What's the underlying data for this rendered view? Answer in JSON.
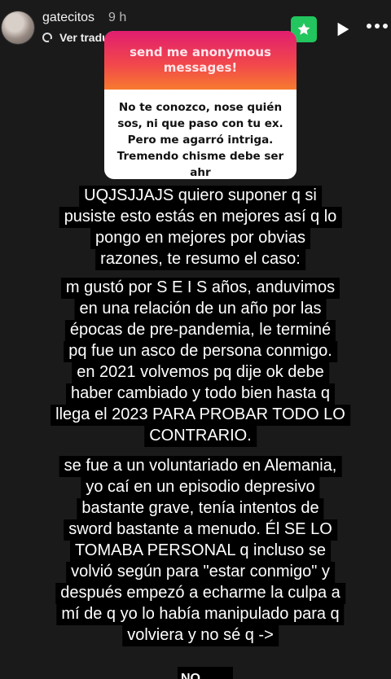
{
  "header": {
    "username": "gatecitos",
    "time": "9 h",
    "translate_label": "Ver traducción",
    "icons": [
      "star-icon",
      "play-icon",
      "more-icon"
    ],
    "colors": {
      "star_button": "#22c55e"
    }
  },
  "card": {
    "title": "send me anonymous messages!",
    "body": "No te conozco, nose quién sos, ni que paso con tu ex. Pero me agarró intriga. Tremendo chisme debe ser ahr"
  },
  "story": {
    "lines": [
      "UQJSJJAJS quiero suponer q si",
      "pusiste esto estás en mejores así q lo",
      "pongo en mejores por obvias",
      "razones, te resumo el caso:",
      "m gustó por  S E I S  años, anduvimos",
      "en una relación de un año por las",
      "épocas de pre-pandemia, le terminé",
      "pq fue un asco de persona conmigo.",
      "en 2021 volvemos pq dije ok debe",
      "haber cambiado y todo bien hasta q",
      "llega el 2023 PARA PROBAR TODO LO",
      "CONTRARIO.",
      "se fue a un voluntariado en Alemania,",
      "yo caí en un episodio depresivo",
      "bastante grave, tenía intentos de",
      "sword bastante a menudo. Él SE LO",
      "TOMABA PERSONAL q incluso se",
      "volvió según para \"estar conmigo\" y",
      "después empezó a echarme la culpa a",
      "mí de q yo lo había manipulado para q",
      "volviera y no sé q ->"
    ],
    "cut_text": "NO"
  }
}
